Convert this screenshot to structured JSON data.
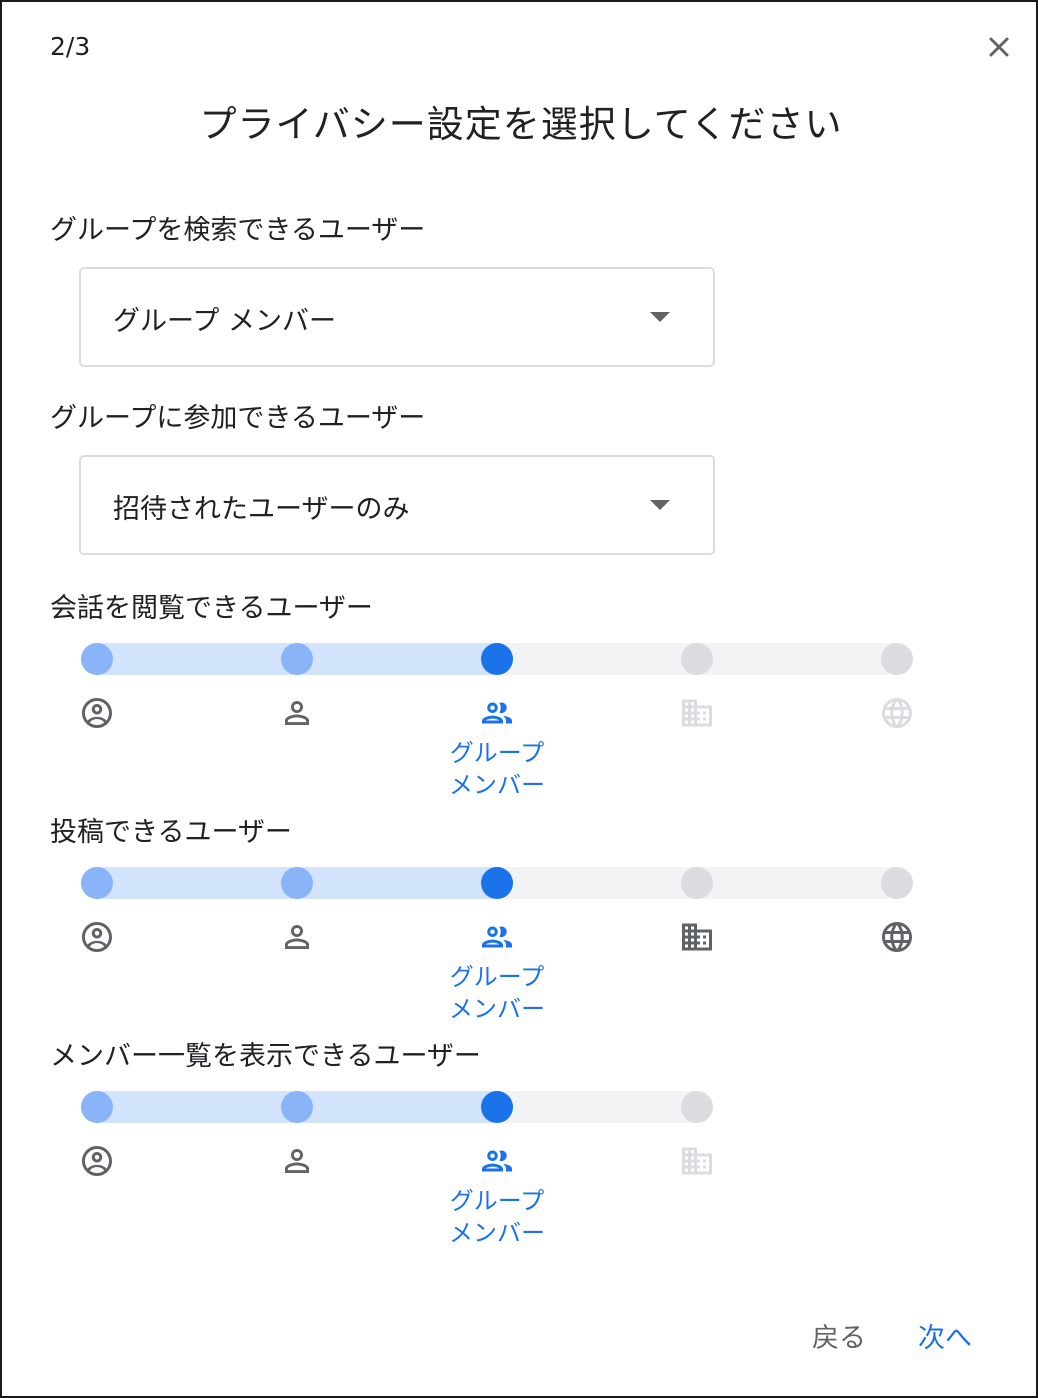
{
  "dialog": {
    "step": "2/3",
    "title": "プライバシー設定を選択してください",
    "close_icon": "close-icon"
  },
  "search": {
    "label": "グループを検索できるユーザー",
    "value": "グループ メンバー"
  },
  "join": {
    "label": "グループに参加できるユーザー",
    "value": "招待されたユーザーのみ"
  },
  "view": {
    "label": "会話を閲覧できるユーザー",
    "selected_label_line1": "グループ",
    "selected_label_line2": "メンバー",
    "selected_index": 2,
    "levels": [
      "account-circle-icon",
      "person-icon",
      "group-icon",
      "domain-icon",
      "globe-icon"
    ]
  },
  "post": {
    "label": "投稿できるユーザー",
    "selected_label_line1": "グループ",
    "selected_label_line2": "メンバー",
    "selected_index": 2,
    "levels": [
      "account-circle-icon",
      "person-icon",
      "group-icon",
      "domain-icon",
      "globe-icon"
    ]
  },
  "members": {
    "label": "メンバー一覧を表示できるユーザー",
    "selected_label_line1": "グループ",
    "selected_label_line2": "メンバー",
    "selected_index": 2,
    "levels": [
      "account-circle-icon",
      "person-icon",
      "group-icon",
      "domain-icon"
    ]
  },
  "footer": {
    "back": "戻る",
    "next": "次へ"
  },
  "colors": {
    "accent": "#1a73e8",
    "accent_light": "#8ab4f8",
    "track_fill": "#d2e3fc",
    "track": "#f1f3f4",
    "inactive": "#dadce0",
    "icon_dark": "#5f6368"
  }
}
